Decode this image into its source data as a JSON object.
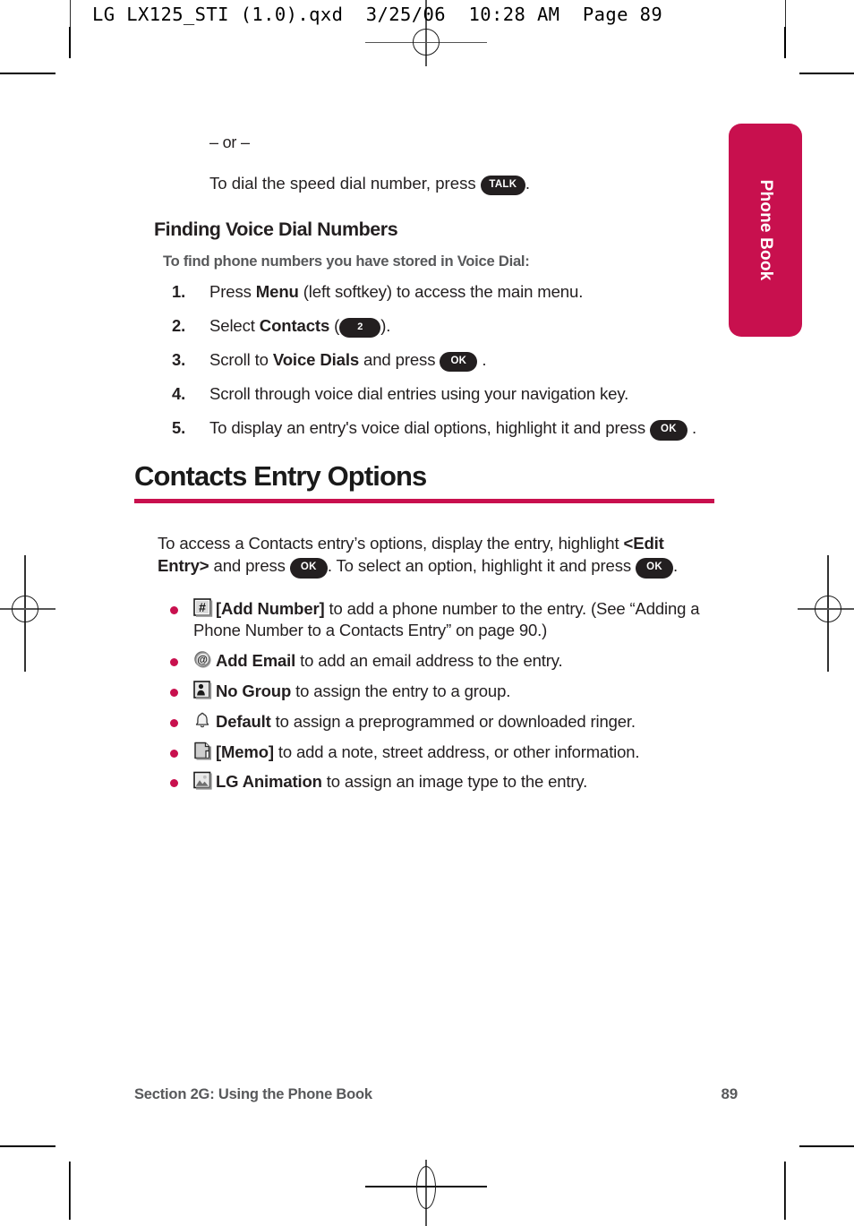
{
  "print_slug": "LG LX125_STI (1.0).qxd  3/25/06  10:28 AM  Page 89",
  "side_tab": {
    "label": "Phone Book",
    "color": "#C8104E"
  },
  "accent_color": "#C8104E",
  "body": {
    "or_separator": "– or –",
    "speed_dial_line": {
      "before": "To dial the speed dial number, press",
      "key": "TALK",
      "after": "."
    },
    "section_heading": "Finding Voice Dial Numbers",
    "sub_heading": "To find phone numbers you have stored in Voice Dial:",
    "steps": [
      {
        "num": "1.",
        "parts": [
          {
            "t": "Press ",
            "b": false
          },
          {
            "t": "Menu",
            "b": true
          },
          {
            "t": " (left softkey) to access the main menu.",
            "b": false
          }
        ]
      },
      {
        "num": "2.",
        "parts": [
          {
            "t": "Select ",
            "b": false
          },
          {
            "t": "Contacts",
            "b": true
          },
          {
            "t": " (",
            "b": false
          },
          {
            "key": "2"
          },
          {
            "t": ").",
            "b": false
          }
        ]
      },
      {
        "num": "3.",
        "parts": [
          {
            "t": "Scroll to ",
            "b": false
          },
          {
            "t": "Voice Dials",
            "b": true
          },
          {
            "t": " and press ",
            "b": false
          },
          {
            "key": "OK"
          },
          {
            "t": ".",
            "b": false
          }
        ]
      },
      {
        "num": "4.",
        "parts": [
          {
            "t": "Scroll through voice dial entries using your navigation key.",
            "b": false
          }
        ]
      },
      {
        "num": "5.",
        "parts": [
          {
            "t": "To display an entry's voice dial options, highlight it and press ",
            "b": false
          },
          {
            "key": "OK"
          },
          {
            "t": ".",
            "b": false
          }
        ]
      }
    ],
    "big_title": "Contacts Entry Options",
    "intro_paragraph": {
      "p1": "To access a Contacts entry’s options, display the entry, highlight ",
      "bold1": "<Edit Entry>",
      "p2": " and press ",
      "key1": "OK",
      "p3": ". To select an option, highlight it and press ",
      "key2": "OK",
      "p4": "."
    },
    "options": [
      {
        "icon": "hash-key-icon",
        "label": "[Add Number]",
        "text": " to add a phone number to the entry. (See “Adding a Phone Number to a Contacts Entry” on page 90.)"
      },
      {
        "icon": "at-email-icon",
        "label": "Add Email",
        "text": " to add an email address to the entry."
      },
      {
        "icon": "group-person-icon",
        "label": "No Group",
        "text": " to assign the entry to a group."
      },
      {
        "icon": "bell-ringer-icon",
        "label": "Default",
        "text": " to assign a preprogrammed or downloaded ringer."
      },
      {
        "icon": "memo-note-icon",
        "label": "[Memo]",
        "text": " to add a note, street address, or other information."
      },
      {
        "icon": "picture-animation-icon",
        "label": "LG Animation",
        "text": " to assign an image type to the entry."
      }
    ]
  },
  "footer": {
    "section_label": "Section 2G: Using the Phone Book",
    "page_number": "89"
  }
}
